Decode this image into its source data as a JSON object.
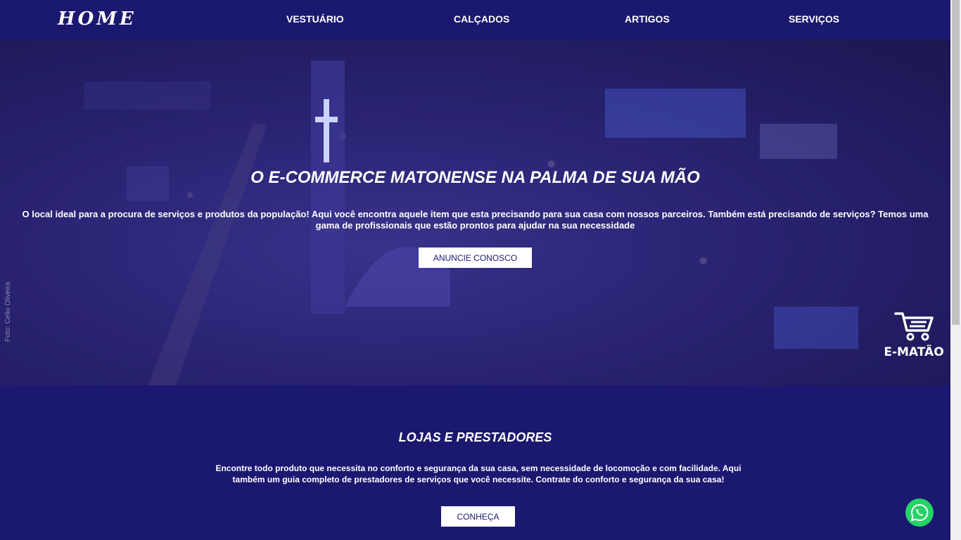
{
  "nav": {
    "brand": "HOME",
    "links": [
      "VESTUÁRIO",
      "CALÇADOS",
      "ARTIGOS",
      "SERVIÇOS"
    ]
  },
  "hero": {
    "title": "O E-COMMERCE MATONENSE NA PALMA DE SUA MÃO",
    "text": "O local ideal para a procura de serviços e produtos da população! Aqui você encontra aquele item que esta precisando para sua casa com nossos parceiros. Também está precisando de serviços? Temos uma gama de profissionais que estão prontos para ajudar na sua necessidade",
    "button": "ANUNCIE CONOSCO",
    "photo_credit": "Foto: Celio Oliveira",
    "logo_text": "E-MATÃO"
  },
  "section": {
    "title": "LOJAS E PRESTADORES",
    "text": "Encontre todo produto que necessita no conforto e segurança da sua casa, sem necessidade de locomoção e com facilidade. Aqui também um guia completo de prestadores de serviços que você necessite. Contrate do conforto e segurança da sua casa!",
    "button": "CONHEÇA"
  },
  "colors": {
    "primary": "#1b1870",
    "whatsapp": "#25d366"
  },
  "icons": [
    "shopping-cart-icon",
    "whatsapp-icon"
  ]
}
